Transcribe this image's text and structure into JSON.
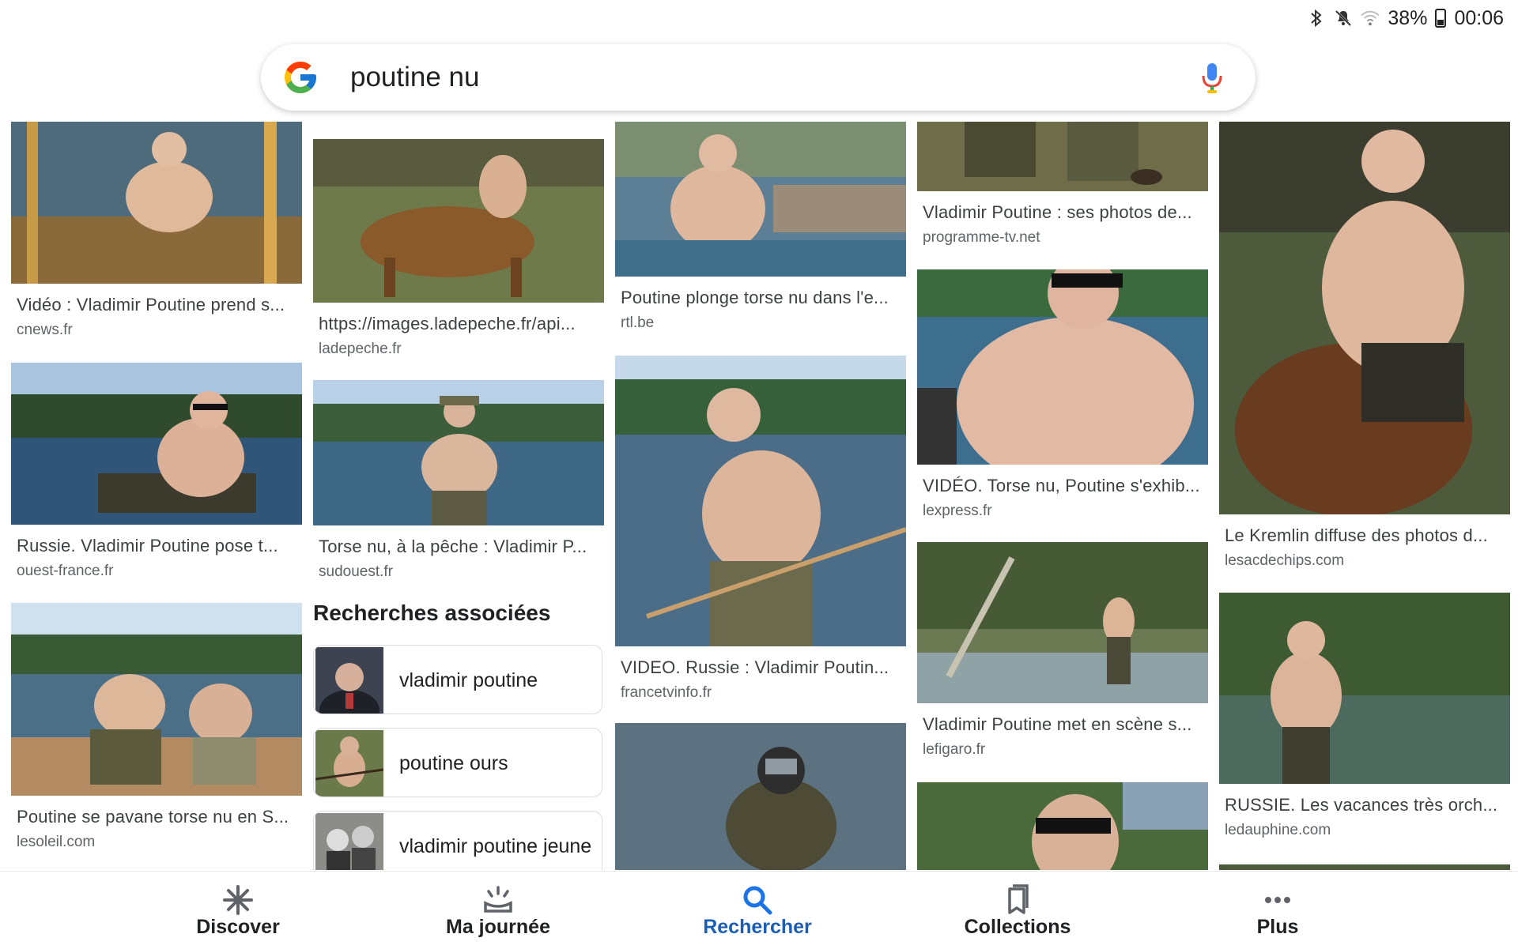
{
  "status_bar": {
    "battery": "38%",
    "time": "00:06",
    "icons": [
      "bluetooth-icon",
      "mute-icon",
      "wifi-icon",
      "battery-icon"
    ]
  },
  "search": {
    "query": "poutine nu",
    "logo": "google-logo",
    "mic": "mic-icon"
  },
  "results": {
    "col1": [
      {
        "caption": "Vidéo : Vladimir Poutine prend s...",
        "source": "cnews.fr"
      },
      {
        "caption": "Russie. Vladimir Poutine pose t...",
        "source": "ouest-france.fr"
      },
      {
        "caption": "Poutine se pavane torse nu en S...",
        "source": "lesoleil.com"
      }
    ],
    "col2": [
      {
        "caption": "https://images.ladepeche.fr/api...",
        "source": "ladepeche.fr"
      },
      {
        "caption": "Torse nu, à la pêche : Vladimir P...",
        "source": "sudouest.fr"
      }
    ],
    "col3": [
      {
        "caption": "Poutine plonge torse nu dans l'e...",
        "source": "rtl.be"
      },
      {
        "caption": "VIDEO. Russie : Vladimir Poutin...",
        "source": "francetvinfo.fr"
      }
    ],
    "col4": [
      {
        "caption": "Vladimir Poutine : ses photos de...",
        "source": "programme-tv.net"
      },
      {
        "caption": "VIDÉO. Torse nu, Poutine s'exhib...",
        "source": "lexpress.fr"
      },
      {
        "caption": "Vladimir Poutine met en scène s...",
        "source": "lefigaro.fr"
      }
    ],
    "col5": [
      {
        "caption": "Le Kremlin diffuse des photos d...",
        "source": "lesacdechips.com"
      },
      {
        "caption": "RUSSIE. Les vacances très orch...",
        "source": "ledauphine.com"
      }
    ]
  },
  "related": {
    "title": "Recherches associées",
    "items": [
      "vladimir poutine",
      "poutine ours",
      "vladimir poutine jeune"
    ]
  },
  "nav": {
    "items": [
      {
        "label": "Discover",
        "icon": "asterisk-icon"
      },
      {
        "label": "Ma journée",
        "icon": "sunrise-icon"
      },
      {
        "label": "Rechercher",
        "icon": "search-icon",
        "active": true
      },
      {
        "label": "Collections",
        "icon": "bookmark-icon"
      },
      {
        "label": "Plus",
        "icon": "more-icon"
      }
    ]
  },
  "colors": {
    "accent": "#1a73e8",
    "active_nav": "#1a5fb4",
    "caption": "#3c4043",
    "source": "#5f6368"
  }
}
